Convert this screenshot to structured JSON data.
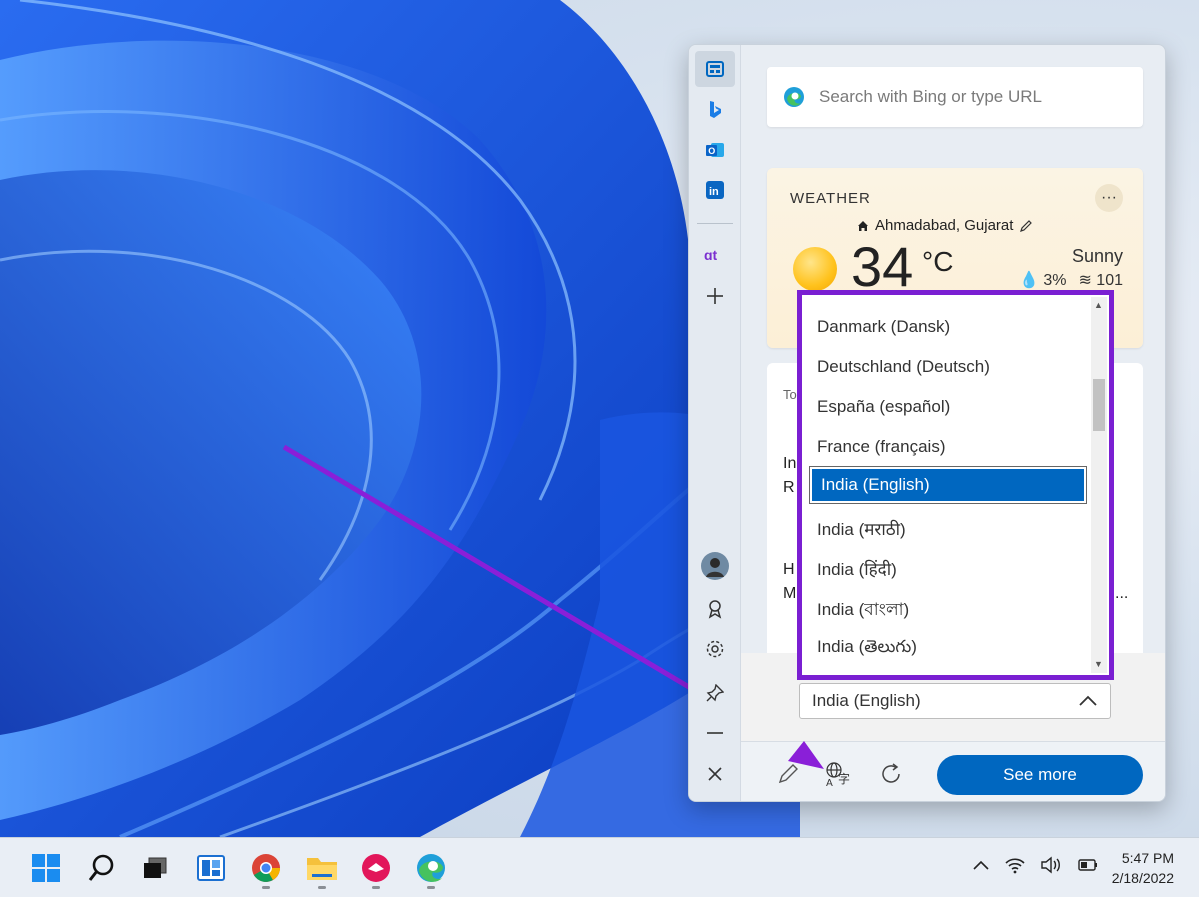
{
  "sidebar": {
    "rail_icons": [
      "news-icon",
      "bing-icon",
      "outlook-icon",
      "linkedin-icon",
      "guiding-tech-icon",
      "add-icon",
      "avatar",
      "trophy-icon",
      "gear-icon",
      "pin-icon",
      "minimize-icon",
      "close-icon"
    ]
  },
  "search": {
    "placeholder": "Search with Bing or type URL"
  },
  "weather": {
    "title": "WEATHER",
    "more": "···",
    "location": "Ahmadabad, Gujarat",
    "temperature": "34",
    "unit": "°C",
    "condition": "Sunny",
    "precip": "3%",
    "aqi": "101"
  },
  "news": {
    "frag1": "To",
    "frag2": "In",
    "frag3": "R",
    "frag4": "H",
    "frag5": "M",
    "frag6": "..."
  },
  "language": {
    "options": [
      "Danmark (Dansk)",
      "Deutschland (Deutsch)",
      "España (español)",
      "France (français)",
      "India (English)",
      "India (मराठी)",
      "India (हिंदी)",
      "India (বাংলা)",
      "India (తెలుగు)"
    ],
    "selected": "India (English)"
  },
  "bottom_bar": {
    "see_more": "See more"
  },
  "taskbar": {
    "time": "5:47 PM",
    "date": "2/18/2022"
  }
}
